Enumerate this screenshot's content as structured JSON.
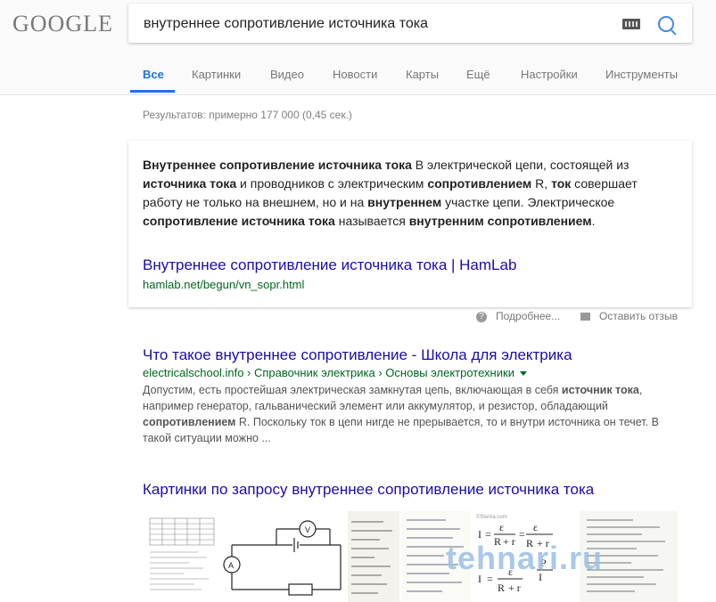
{
  "header": {
    "logo": "GOOGLE",
    "search": {
      "value": "внутреннее сопротивление источника тока",
      "placeholder": ""
    }
  },
  "tabs": [
    {
      "label": "Все",
      "active": true
    },
    {
      "label": "Картинки"
    },
    {
      "label": "Видео"
    },
    {
      "label": "Новости"
    },
    {
      "label": "Карты"
    },
    {
      "label": "Ещё"
    },
    {
      "label": "Настройки"
    },
    {
      "label": "Инструменты"
    }
  ],
  "stats": "Результатов: примерно 177 000 (0,45 сек.)",
  "featured_snippet": {
    "segments": [
      {
        "t": "Внутреннее сопротивление источника тока",
        "b": true
      },
      {
        "t": " В электрической цепи, состоящей из ",
        "b": false
      },
      {
        "t": "источника тока",
        "b": true
      },
      {
        "t": " и проводников с электрическим ",
        "b": false
      },
      {
        "t": "сопротивлением",
        "b": true
      },
      {
        "t": " R, ",
        "b": false
      },
      {
        "t": "ток",
        "b": true
      },
      {
        "t": " совершает работу не только на внешнем, но и на ",
        "b": false
      },
      {
        "t": "внутреннем",
        "b": true
      },
      {
        "t": " участке цепи. Электрическое ",
        "b": false
      },
      {
        "t": "сопротивление источника тока",
        "b": true
      },
      {
        "t": " называется ",
        "b": false
      },
      {
        "t": "внутренним сопротивлением",
        "b": true
      },
      {
        "t": ".",
        "b": false
      }
    ],
    "link_title": "Внутреннее сопротивление источника тока | HamLab",
    "url": "hamlab.net/begun/vn_sopr.html"
  },
  "snippet_footer": {
    "more_label": "Подробнее...",
    "feedback_label": "Оставить отзыв"
  },
  "result": {
    "title": "Что такое внутреннее сопротивление - Школа для электрика",
    "url": "electricalschool.info › Справочник электрика › Основы электротехники",
    "desc_segments": [
      {
        "t": "Допустим, есть простейшая электрическая замкнутая цепь, включающая в себя ",
        "b": false
      },
      {
        "t": "источник тока",
        "b": true
      },
      {
        "t": ", например генератор, гальванический элемент или аккумулятор, и резистор, обладающий ",
        "b": false
      },
      {
        "t": "сопротивлением",
        "b": true
      },
      {
        "t": " R. Поскольку ток в цепи нигде не прерывается, то и внутри источника он течет. В такой ситуации можно ...",
        "b": false
      }
    ]
  },
  "images": {
    "header": "Картинки по запросу внутреннее сопротивление источника тока",
    "watermark": "tehnari.ru",
    "formula_source": "©Sterka.com"
  },
  "colors": {
    "link": "#1a0dab",
    "url_green": "#006621",
    "tab_active": "#1a73e8"
  }
}
